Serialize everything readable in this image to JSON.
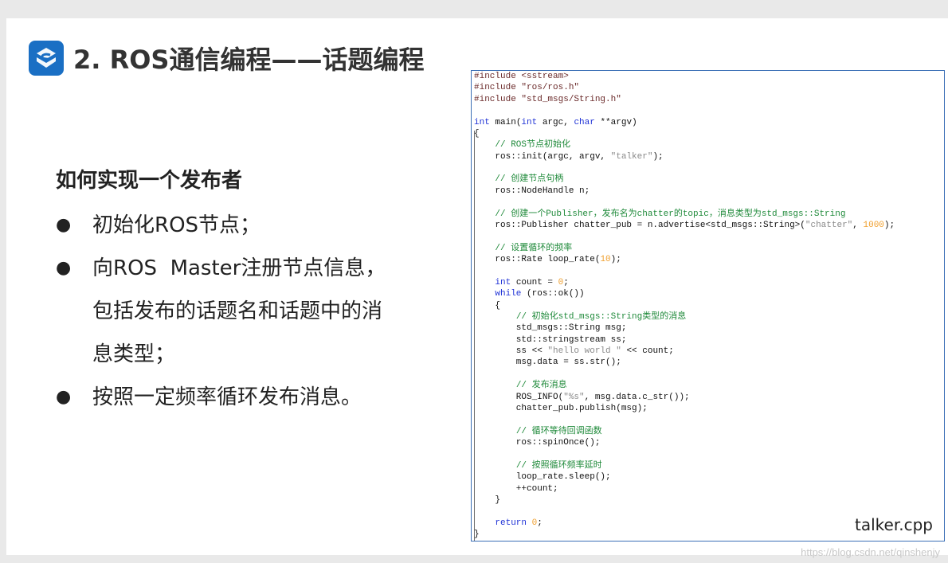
{
  "slide": {
    "title": "2. ROS通信编程——话题编程",
    "heading": "如何实现一个发布者",
    "bullets": [
      {
        "lines": [
          "初始化ROS节点；"
        ]
      },
      {
        "lines": [
          "向ROS  Master注册节点信息，",
          "包括发布的话题名和话题中的消",
          "息类型；"
        ]
      },
      {
        "lines": [
          "按照一定频率循环发布消息。"
        ]
      }
    ]
  },
  "code": {
    "filename": "talker.cpp",
    "lines": [
      [
        [
          "pp",
          "#include <sstream>"
        ]
      ],
      [
        [
          "pp",
          "#include \"ros/ros.h\""
        ]
      ],
      [
        [
          "pp",
          "#include \"std_msgs/String.h\""
        ]
      ],
      [],
      [
        [
          "kw",
          "int"
        ],
        [
          "t",
          " main("
        ],
        [
          "kw",
          "int"
        ],
        [
          "t",
          " argc, "
        ],
        [
          "kw",
          "char"
        ],
        [
          "t",
          " **argv)"
        ]
      ],
      [
        [
          "t",
          "{"
        ]
      ],
      [
        [
          "t",
          "    "
        ],
        [
          "cm",
          "// ROS节点初始化"
        ]
      ],
      [
        [
          "t",
          "    ros::init(argc, argv, "
        ],
        [
          "st",
          "\"talker\""
        ],
        [
          "t",
          ");"
        ]
      ],
      [],
      [
        [
          "t",
          "    "
        ],
        [
          "cm",
          "// 创建节点句柄"
        ]
      ],
      [
        [
          "t",
          "    ros::NodeHandle n;"
        ]
      ],
      [],
      [
        [
          "t",
          "    "
        ],
        [
          "cm",
          "// 创建一个Publisher，发布名为chatter的topic，消息类型为std_msgs::String"
        ]
      ],
      [
        [
          "t",
          "    ros::Publisher chatter_pub = n.advertise<std_msgs::String>("
        ],
        [
          "st",
          "\"chatter\""
        ],
        [
          "t",
          ", "
        ],
        [
          "nm",
          "1000"
        ],
        [
          "t",
          ");"
        ]
      ],
      [],
      [
        [
          "t",
          "    "
        ],
        [
          "cm",
          "// 设置循环的频率"
        ]
      ],
      [
        [
          "t",
          "    ros::Rate loop_rate("
        ],
        [
          "nm",
          "10"
        ],
        [
          "t",
          ");"
        ]
      ],
      [],
      [
        [
          "t",
          "    "
        ],
        [
          "kw",
          "int"
        ],
        [
          "t",
          " count = "
        ],
        [
          "nm",
          "0"
        ],
        [
          "t",
          ";"
        ]
      ],
      [
        [
          "t",
          "    "
        ],
        [
          "kw",
          "while"
        ],
        [
          "t",
          " (ros::ok())"
        ]
      ],
      [
        [
          "t",
          "    {"
        ]
      ],
      [
        [
          "t",
          "        "
        ],
        [
          "cm",
          "// 初始化std_msgs::String类型的消息"
        ]
      ],
      [
        [
          "t",
          "        std_msgs::String msg;"
        ]
      ],
      [
        [
          "t",
          "        std::stringstream ss;"
        ]
      ],
      [
        [
          "t",
          "        ss << "
        ],
        [
          "st",
          "\"hello world \""
        ],
        [
          "t",
          " << count;"
        ]
      ],
      [
        [
          "t",
          "        msg.data = ss.str();"
        ]
      ],
      [],
      [
        [
          "t",
          "        "
        ],
        [
          "cm",
          "// 发布消息"
        ]
      ],
      [
        [
          "t",
          "        ROS_INFO("
        ],
        [
          "st",
          "\"%s\""
        ],
        [
          "t",
          ", msg.data.c_str());"
        ]
      ],
      [
        [
          "t",
          "        chatter_pub.publish(msg);"
        ]
      ],
      [],
      [
        [
          "t",
          "        "
        ],
        [
          "cm",
          "// 循环等待回调函数"
        ]
      ],
      [
        [
          "t",
          "        ros::spinOnce();"
        ]
      ],
      [],
      [
        [
          "t",
          "        "
        ],
        [
          "cm",
          "// 按照循环频率延时"
        ]
      ],
      [
        [
          "t",
          "        loop_rate.sleep();"
        ]
      ],
      [
        [
          "t",
          "        ++count;"
        ]
      ],
      [
        [
          "t",
          "    }"
        ]
      ],
      [],
      [
        [
          "t",
          "    "
        ],
        [
          "kw",
          "return"
        ],
        [
          "t",
          " "
        ],
        [
          "nm",
          "0"
        ],
        [
          "t",
          ";"
        ]
      ],
      [
        [
          "t",
          "}"
        ]
      ]
    ]
  },
  "watermark": "https://blog.csdn.net/qinshenjy",
  "colors": {
    "logo_bg": "#1a6fc4",
    "box_border": "#3b6fb6",
    "keyword": "#1f32d6",
    "comment": "#1f8a3a",
    "string": "#8a8a8a",
    "number": "#f0a030"
  }
}
